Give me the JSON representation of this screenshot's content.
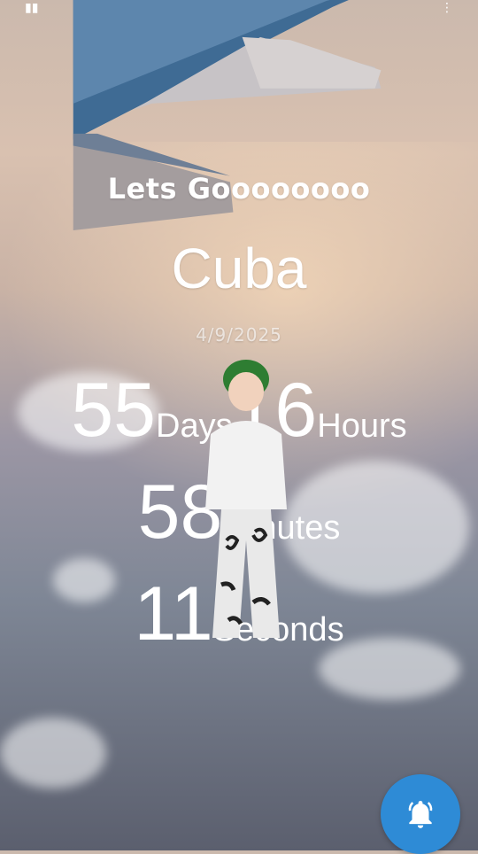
{
  "header": {
    "title": "Lets Goooooooo"
  },
  "countdown": {
    "destination": "Cuba",
    "date": "4/9/2025",
    "days_value": "55",
    "days_label": "Days",
    "hours_value": "16",
    "hours_label": "Hours",
    "minutes_value": "58",
    "minutes_label": "Minutes",
    "seconds_value": "11",
    "seconds_label": "Seconds"
  },
  "fab": {
    "icon": "bell-icon",
    "color": "#2e8bd6"
  }
}
